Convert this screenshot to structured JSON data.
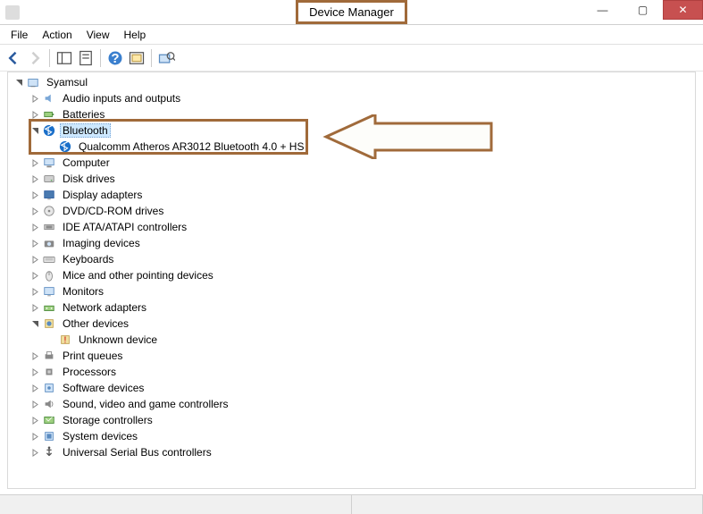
{
  "window": {
    "title": "Device Manager",
    "controls": {
      "min": "—",
      "max": "▢",
      "close": "✕"
    }
  },
  "menu": {
    "file": "File",
    "action": "Action",
    "view": "View",
    "help": "Help"
  },
  "toolbar_icons": [
    "back",
    "forward",
    "show-hide",
    "properties",
    "help",
    "update",
    "scan"
  ],
  "tree": {
    "root": "Syamsul",
    "items": [
      {
        "label": "Audio inputs and outputs",
        "icon": "audio"
      },
      {
        "label": "Batteries",
        "icon": "battery"
      },
      {
        "label": "Bluetooth",
        "icon": "bluetooth",
        "expanded": true,
        "selected": true,
        "children": [
          {
            "label": "Qualcomm Atheros AR3012 Bluetooth 4.0 + HS",
            "icon": "bluetooth"
          }
        ]
      },
      {
        "label": "Computer",
        "icon": "computer"
      },
      {
        "label": "Disk drives",
        "icon": "disk"
      },
      {
        "label": "Display adapters",
        "icon": "display"
      },
      {
        "label": "DVD/CD-ROM drives",
        "icon": "cdrom"
      },
      {
        "label": "IDE ATA/ATAPI controllers",
        "icon": "ide"
      },
      {
        "label": "Imaging devices",
        "icon": "imaging"
      },
      {
        "label": "Keyboards",
        "icon": "keyboard"
      },
      {
        "label": "Mice and other pointing devices",
        "icon": "mouse"
      },
      {
        "label": "Monitors",
        "icon": "monitor"
      },
      {
        "label": "Network adapters",
        "icon": "network"
      },
      {
        "label": "Other devices",
        "icon": "other",
        "expanded": true,
        "children": [
          {
            "label": "Unknown device",
            "icon": "unknown"
          }
        ]
      },
      {
        "label": "Print queues",
        "icon": "printer"
      },
      {
        "label": "Processors",
        "icon": "cpu"
      },
      {
        "label": "Software devices",
        "icon": "software"
      },
      {
        "label": "Sound, video and game controllers",
        "icon": "sound"
      },
      {
        "label": "Storage controllers",
        "icon": "storage"
      },
      {
        "label": "System devices",
        "icon": "system"
      },
      {
        "label": "Universal Serial Bus controllers",
        "icon": "usb"
      }
    ]
  }
}
